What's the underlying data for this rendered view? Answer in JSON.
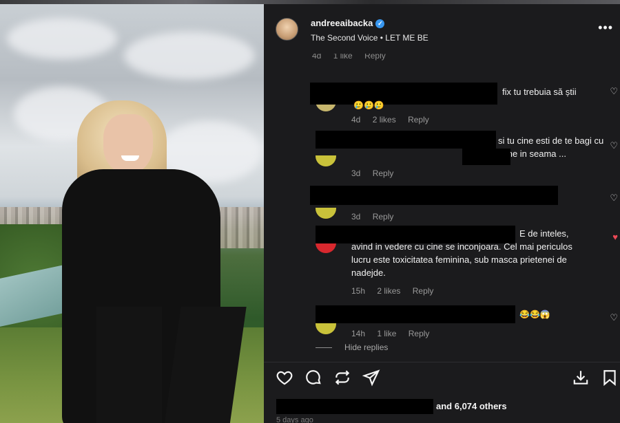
{
  "post": {
    "username": "andreeaibacka",
    "verified_icon": "verified-badge-icon",
    "audio": "The Second Voice • LET ME BE",
    "more_label": "•••"
  },
  "previous_comment_meta": {
    "time": "4d",
    "likes": "1 like",
    "reply": "Reply"
  },
  "comments": [
    {
      "text": "fix tu trebuia să știi",
      "emoji": "🥲🥲🥲",
      "time": "4d",
      "likes": "2 likes",
      "reply": "Reply",
      "liked": false
    },
    {
      "text": "si tu cine esti de te bagi cu mine in seama ...",
      "time": "3d",
      "likes": "",
      "reply": "Reply",
      "liked": false
    },
    {
      "text": "",
      "time": "3d",
      "likes": "",
      "reply": "Reply",
      "liked": false
    },
    {
      "text": "E de inteles, avind in vedere cu cine se inconjoara. Cel mai periculos lucru este toxicitatea feminina, sub masca prietenei de nadejde.",
      "time": "15h",
      "likes": "2 likes",
      "reply": "Reply",
      "liked": true
    },
    {
      "text": "",
      "emoji": "😂😂😱",
      "time": "14h",
      "likes": "1 like",
      "reply": "Reply",
      "liked": false
    }
  ],
  "hide_replies": "Hide replies",
  "actions": {
    "like": "heart-icon",
    "comment": "comment-icon",
    "share": "repost-icon",
    "send": "send-icon",
    "download": "download-icon",
    "save": "bookmark-icon"
  },
  "likes_summary": "and 6,074 others",
  "posted": "5 days ago",
  "colors": {
    "panel": "#1b1b1d",
    "verified": "#3897f0",
    "liked_heart": "#ed4956"
  }
}
